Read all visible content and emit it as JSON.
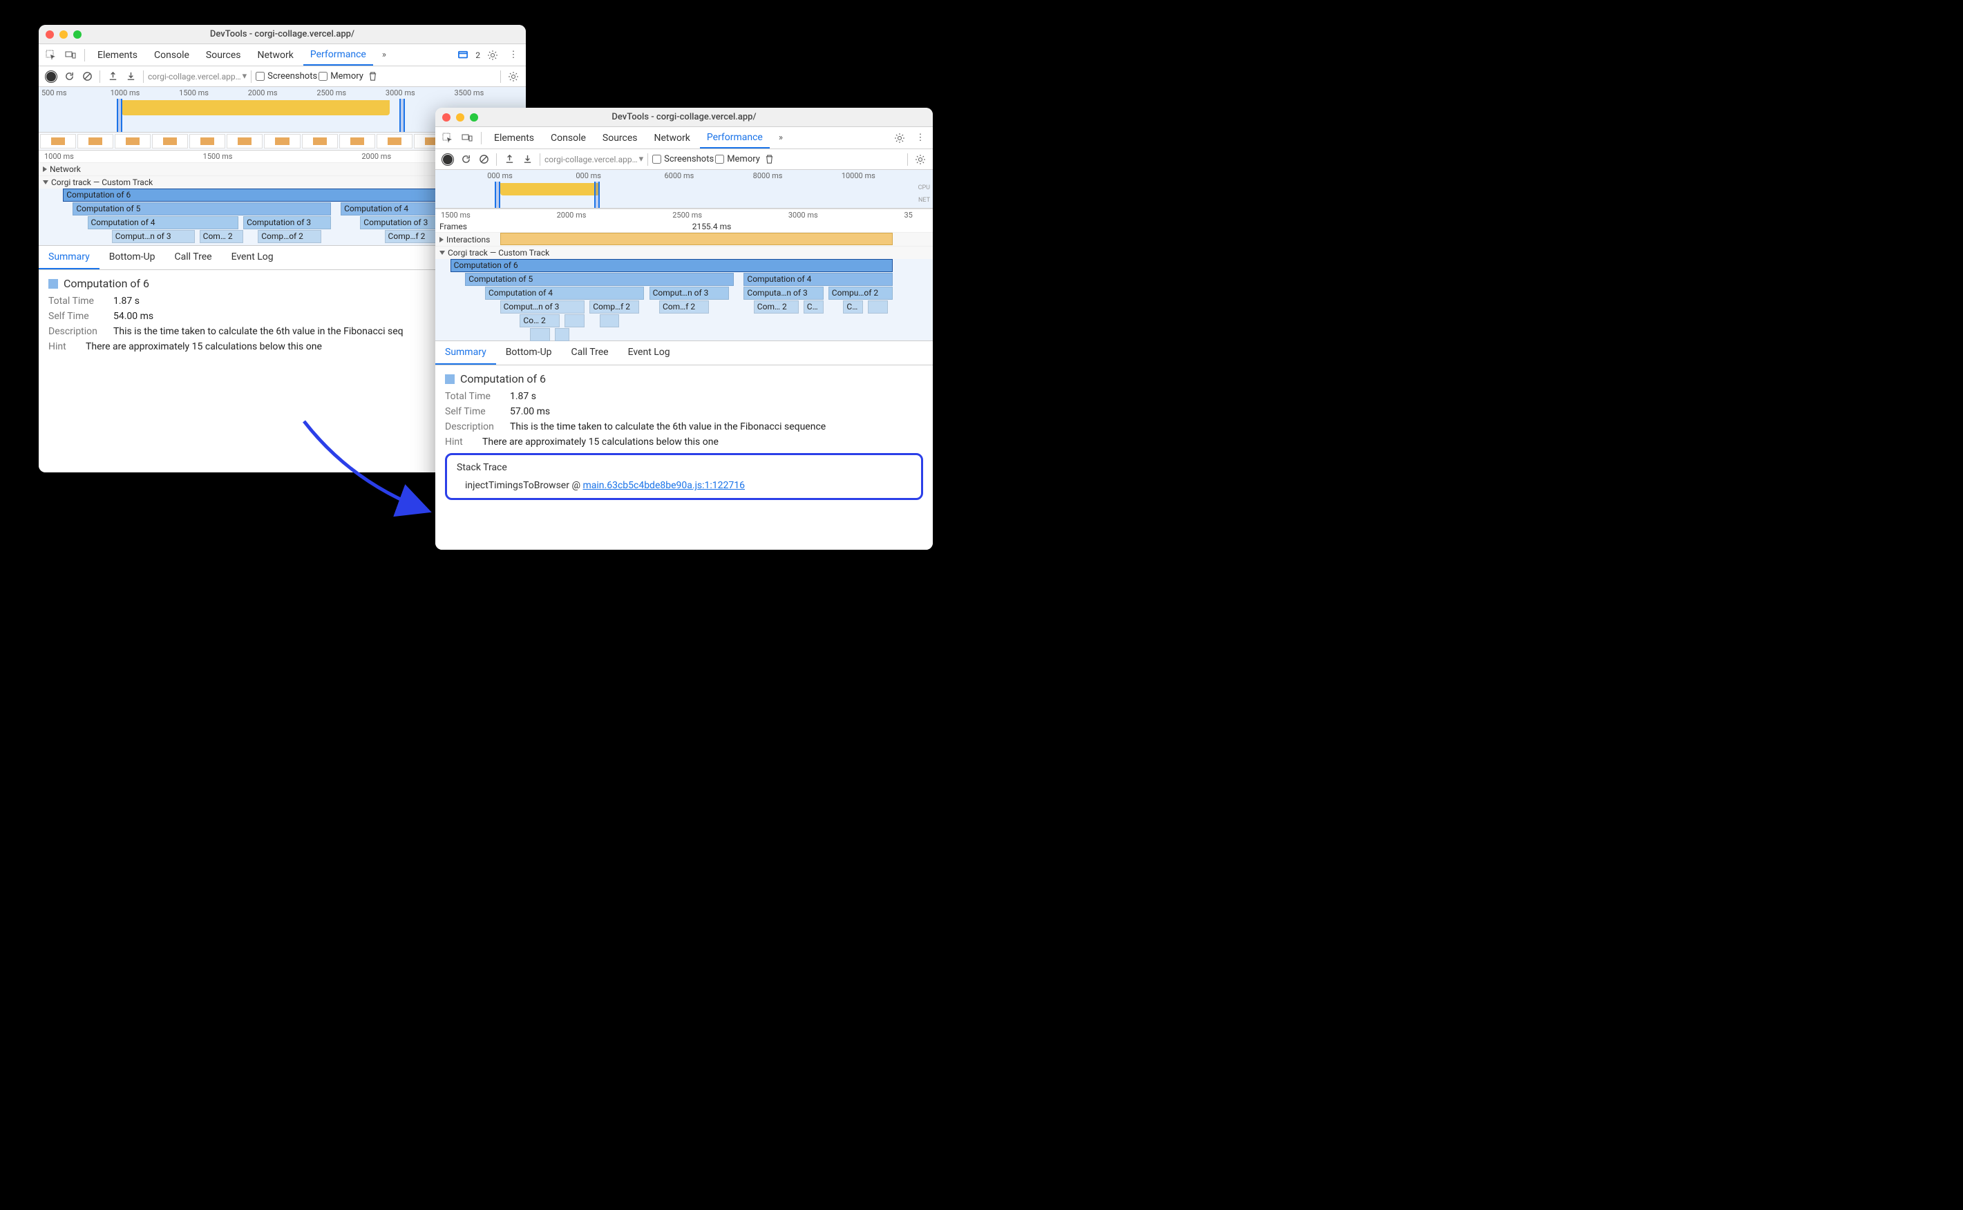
{
  "window_title": "DevTools - corgi-collage.vercel.app/",
  "tabs": {
    "elements": "Elements",
    "console": "Console",
    "sources": "Sources",
    "network": "Network",
    "performance": "Performance"
  },
  "toolbar": {
    "url": "corgi-collage.vercel.app…",
    "screenshots": "Screenshots",
    "memory": "Memory"
  },
  "badge_count": "2",
  "win1": {
    "overview_ticks": [
      "500 ms",
      "1000 ms",
      "1500 ms",
      "2000 ms",
      "2500 ms",
      "3000 ms",
      "3500 ms"
    ],
    "timeline_ticks": [
      "1000 ms",
      "1500 ms",
      "2000 ms"
    ],
    "tracks": {
      "network": "Network",
      "custom": "Corgi track — Custom Track"
    },
    "flame": {
      "r0": "Computation of 6",
      "r1a": "Computation of 5",
      "r1b": "Computation of 4",
      "r2a": "Computation of 4",
      "r2b": "Computation of 3",
      "r2c": "Computation of 3",
      "r3a": "Comput…n of 3",
      "r3b": "Com… 2",
      "r3c": "Comp…of 2",
      "r3d": "Comp…f 2"
    },
    "detail_tabs": {
      "summary": "Summary",
      "bottom_up": "Bottom-Up",
      "call_tree": "Call Tree",
      "event_log": "Event Log"
    },
    "summary": {
      "title": "Computation of 6",
      "total_time_label": "Total Time",
      "total_time": "1.87 s",
      "self_time_label": "Self Time",
      "self_time": "54.00 ms",
      "description_label": "Description",
      "description": "This is the time taken to calculate the 6th value in the Fibonacci seq",
      "hint_label": "Hint",
      "hint": "There are approximately 15 calculations below this one"
    }
  },
  "win2": {
    "overview_ticks": [
      "000 ms",
      "000 ms",
      "6000 ms",
      "8000 ms",
      "10000 ms"
    ],
    "cpu_label": "CPU",
    "net_label": "NET",
    "timeline_ticks": [
      "1500 ms",
      "2000 ms",
      "2500 ms",
      "3000 ms",
      "35"
    ],
    "frames_label": "Frames",
    "frames_value": "2155.4 ms",
    "interactions_label": "Interactions",
    "custom_track": "Corgi track — Custom Track",
    "flame": {
      "r0": "Computation of 6",
      "r1a": "Computation of 5",
      "r1b": "Computation of 4",
      "r2a": "Computation of 4",
      "r2b": "Comput…n of 3",
      "r2c": "Computa…n of 3",
      "r2d": "Compu…of 2",
      "r3a": "Comput…n of 3",
      "r3b": "Comp…f 2",
      "r3c": "Com…f 2",
      "r3d": "Com… 2",
      "r3e": "C…",
      "r3f": "C…",
      "r4a": "Co… 2"
    },
    "detail_tabs": {
      "summary": "Summary",
      "bottom_up": "Bottom-Up",
      "call_tree": "Call Tree",
      "event_log": "Event Log"
    },
    "summary": {
      "title": "Computation of 6",
      "total_time_label": "Total Time",
      "total_time": "1.87 s",
      "self_time_label": "Self Time",
      "self_time": "57.00 ms",
      "description_label": "Description",
      "description": "This is the time taken to calculate the 6th value in the Fibonacci sequence",
      "hint_label": "Hint",
      "hint": "There are approximately 15 calculations below this one"
    },
    "stack": {
      "title": "Stack Trace",
      "fn": "injectTimingsToBrowser @ ",
      "link": "main.63cb5c4bde8be90a.js:1:122716"
    }
  }
}
